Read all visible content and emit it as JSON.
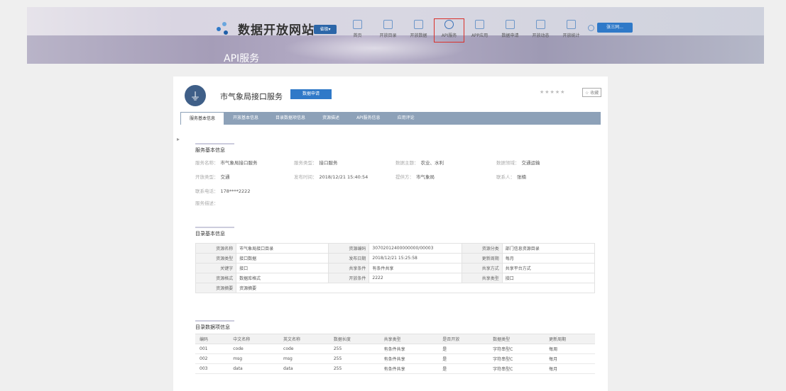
{
  "site": {
    "title": "数据开放网站",
    "city_button": "省级▾"
  },
  "nav": [
    {
      "label": "首页"
    },
    {
      "label": "开放目录"
    },
    {
      "label": "开放数据"
    },
    {
      "label": "API服务"
    },
    {
      "label": "APP应用"
    },
    {
      "label": "数据申请"
    },
    {
      "label": "开放动态"
    },
    {
      "label": "开放统计"
    }
  ],
  "user": {
    "button": "张三同..."
  },
  "page": {
    "subheader": "API服务"
  },
  "service": {
    "name": "市气象局接口服务",
    "apply_button": "数据申请",
    "rating": "★★★★★",
    "favorite": "☆ 收藏"
  },
  "tabs": [
    "服务基本信息",
    "开放基本信息",
    "目录数据项信息",
    "资源描述",
    "API服务信息",
    "应用评论"
  ],
  "basic": {
    "title": "服务基本信息",
    "rows": [
      [
        {
          "k": "服务名称：",
          "v": "市气象局接口服务"
        },
        {
          "k": "服务类型：",
          "v": "接口服务"
        },
        {
          "k": "数据主题：",
          "v": "农业、水利"
        },
        {
          "k": "数据领域：",
          "v": "交通运输"
        }
      ],
      [
        {
          "k": "开放类型：",
          "v": "交通"
        },
        {
          "k": "发布时间：",
          "v": "2018/12/21 15:40:54"
        },
        {
          "k": "提供方：",
          "v": "市气象局"
        },
        {
          "k": "联系人：",
          "v": "张楠"
        }
      ],
      [
        {
          "k": "联系电话：",
          "v": "178****2222"
        }
      ],
      [
        {
          "k": "服务描述：",
          "v": ""
        }
      ]
    ]
  },
  "catalog": {
    "title": "目录基本信息",
    "rows": [
      [
        "资源名称",
        "市气象局接口目录",
        "资源编码",
        "30702012400000000/00003",
        "资源分类",
        "部门信息资源目录"
      ],
      [
        "资源类型",
        "接口数据",
        "发布日期",
        "2018/12/21 15:25:58",
        "更新周期",
        "每月"
      ],
      [
        "关键字",
        "接口",
        "共享条件",
        "有条件共享",
        "共享方式",
        "共享平台方式"
      ],
      [
        "资源格式",
        "数据库格式",
        "开放条件",
        "2222",
        "共享类型",
        "接口"
      ],
      [
        "资源摘要",
        "资源摘要",
        "",
        "",
        "",
        ""
      ]
    ]
  },
  "items": {
    "title": "目录数据项信息",
    "headers": [
      "编码",
      "中文名称",
      "英文名称",
      "数据长度",
      "共享类型",
      "是否开放",
      "数据类型",
      "更新周期"
    ],
    "rows": [
      [
        "001",
        "code",
        "code",
        "255",
        "有条件共享",
        "是",
        "字符串型C",
        "每周"
      ],
      [
        "002",
        "msg",
        "msg",
        "255",
        "有条件共享",
        "是",
        "字符串型C",
        "每月"
      ],
      [
        "003",
        "data",
        "data",
        "255",
        "有条件共享",
        "是",
        "字符串型C",
        "每月"
      ]
    ]
  }
}
